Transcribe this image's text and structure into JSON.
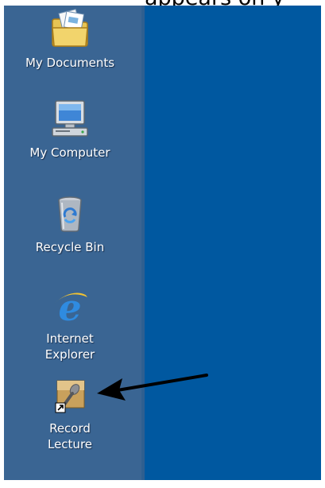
{
  "header": {
    "partial_text": "appears on y"
  },
  "desktop": {
    "icons": [
      {
        "label": "My Documents",
        "icon": "my-documents-icon"
      },
      {
        "label": "My Computer",
        "icon": "my-computer-icon"
      },
      {
        "label": "Recycle Bin",
        "icon": "recycle-bin-icon"
      },
      {
        "label": "Internet Explorer",
        "icon": "internet-explorer-icon"
      },
      {
        "label": "Record Lecture",
        "icon": "record-lecture-icon"
      }
    ]
  },
  "annotation": {
    "icon": "arrow-left-icon",
    "color": "#000000"
  },
  "colors": {
    "sidebar": "#3a6593",
    "desktop": "#0058a0",
    "label_text": "#ffffff"
  }
}
